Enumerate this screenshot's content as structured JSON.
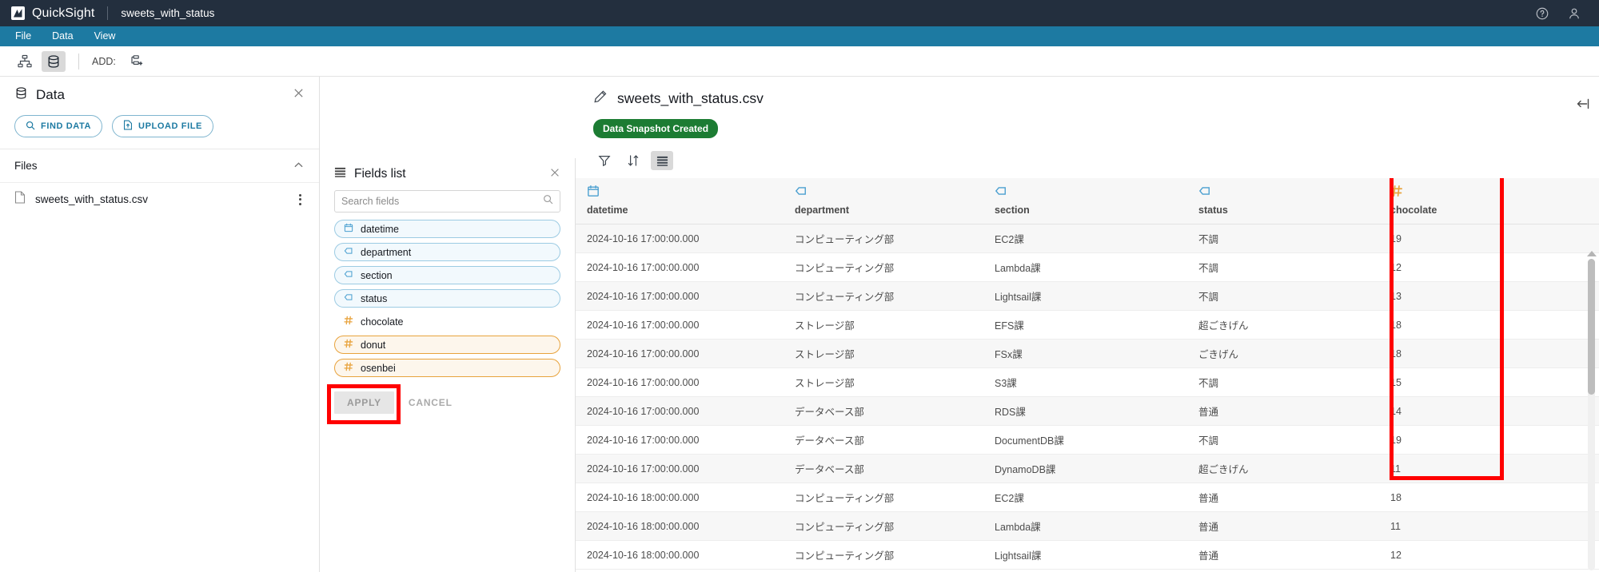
{
  "topbar": {
    "brand": "QuickSight",
    "document_name": "sweets_with_status",
    "help_icon": "help-circle-icon",
    "user_icon": "user-account-icon"
  },
  "menubar": {
    "items": [
      {
        "label": "File"
      },
      {
        "label": "Data"
      },
      {
        "label": "View"
      }
    ]
  },
  "toolbar": {
    "diagram_view_icon": "data-flow-diagram-icon",
    "table_view_icon": "database-table-icon",
    "add_label": "ADD:",
    "add_icon": "add-node-icon"
  },
  "data_panel": {
    "title": "Data",
    "title_icon": "database-icon",
    "close_icon": "close-icon",
    "find_data_label": "FIND DATA",
    "find_data_icon": "search-icon",
    "upload_file_label": "UPLOAD FILE",
    "upload_file_icon": "file-upload-icon",
    "files_section_label": "Files",
    "files_collapse_icon": "chevron-up-icon",
    "files": [
      {
        "name": "sweets_with_status.csv",
        "icon": "file-icon",
        "menu_icon": "kebab-menu-icon"
      }
    ]
  },
  "fields_panel": {
    "title": "Fields list",
    "title_icon": "fields-list-icon",
    "close_icon": "close-icon",
    "search_placeholder": "Search fields",
    "search_value": "",
    "search_icon": "search-icon",
    "fields": [
      {
        "label": "datetime",
        "type": "date",
        "icon": "calendar-icon",
        "selected": true
      },
      {
        "label": "department",
        "type": "dimension",
        "icon": "string-tag-icon",
        "selected": true
      },
      {
        "label": "section",
        "type": "dimension",
        "icon": "string-tag-icon",
        "selected": true
      },
      {
        "label": "status",
        "type": "dimension",
        "icon": "string-tag-icon",
        "selected": true
      },
      {
        "label": "chocolate",
        "type": "measure",
        "icon": "hash-icon",
        "selected": false
      },
      {
        "label": "donut",
        "type": "measure",
        "icon": "hash-icon",
        "selected": true
      },
      {
        "label": "osenbei",
        "type": "measure",
        "icon": "hash-icon",
        "selected": true
      }
    ],
    "apply_label": "APPLY",
    "cancel_label": "CANCEL"
  },
  "main": {
    "title": "sweets_with_status.csv",
    "edit_icon": "pencil-edit-icon",
    "status_badge": "Data Snapshot Created",
    "tools": [
      {
        "name": "filter",
        "icon": "filter-icon",
        "active": false
      },
      {
        "name": "sort",
        "icon": "sort-arrows-icon",
        "active": false
      },
      {
        "name": "fields-list",
        "icon": "fields-list-icon",
        "active": true
      }
    ],
    "collapse_panel_icon": "collapse-right-panel-icon",
    "scrollbar_up_icon": "scroll-up-arrow-icon"
  },
  "table": {
    "columns": [
      {
        "key": "datetime",
        "label": "datetime",
        "icon": "calendar-icon",
        "type": "date"
      },
      {
        "key": "department",
        "label": "department",
        "icon": "string-tag-icon",
        "type": "dimension"
      },
      {
        "key": "section",
        "label": "section",
        "icon": "string-tag-icon",
        "type": "dimension"
      },
      {
        "key": "status",
        "label": "status",
        "icon": "string-tag-icon",
        "type": "dimension"
      },
      {
        "key": "chocolate",
        "label": "chocolate",
        "icon": "hash-icon",
        "type": "measure",
        "highlighted": true
      }
    ],
    "rows": [
      [
        "2024-10-16 17:00:00.000",
        "コンピューティング部",
        "EC2課",
        "不調",
        "19"
      ],
      [
        "2024-10-16 17:00:00.000",
        "コンピューティング部",
        "Lambda課",
        "不調",
        "12"
      ],
      [
        "2024-10-16 17:00:00.000",
        "コンピューティング部",
        "Lightsail課",
        "不調",
        "13"
      ],
      [
        "2024-10-16 17:00:00.000",
        "ストレージ部",
        "EFS課",
        "超ごきげん",
        "18"
      ],
      [
        "2024-10-16 17:00:00.000",
        "ストレージ部",
        "FSx課",
        "ごきげん",
        "18"
      ],
      [
        "2024-10-16 17:00:00.000",
        "ストレージ部",
        "S3課",
        "不調",
        "15"
      ],
      [
        "2024-10-16 17:00:00.000",
        "データベース部",
        "RDS課",
        "普通",
        "14"
      ],
      [
        "2024-10-16 17:00:00.000",
        "データベース部",
        "DocumentDB課",
        "不調",
        "19"
      ],
      [
        "2024-10-16 17:00:00.000",
        "データベース部",
        "DynamoDB課",
        "超ごきげん",
        "11"
      ],
      [
        "2024-10-16 18:00:00.000",
        "コンピューティング部",
        "EC2課",
        "普通",
        "18"
      ],
      [
        "2024-10-16 18:00:00.000",
        "コンピューティング部",
        "Lambda課",
        "普通",
        "11"
      ],
      [
        "2024-10-16 18:00:00.000",
        "コンピューティング部",
        "Lightsail課",
        "普通",
        "12"
      ]
    ]
  },
  "colors": {
    "topbar_bg": "#232f3e",
    "menubar_bg": "#1d7aa2",
    "dimension_accent": "#4a9fd0",
    "measure_accent": "#e8a33d",
    "badge_green": "#1c7c33",
    "annotation_red": "#ff0000"
  }
}
